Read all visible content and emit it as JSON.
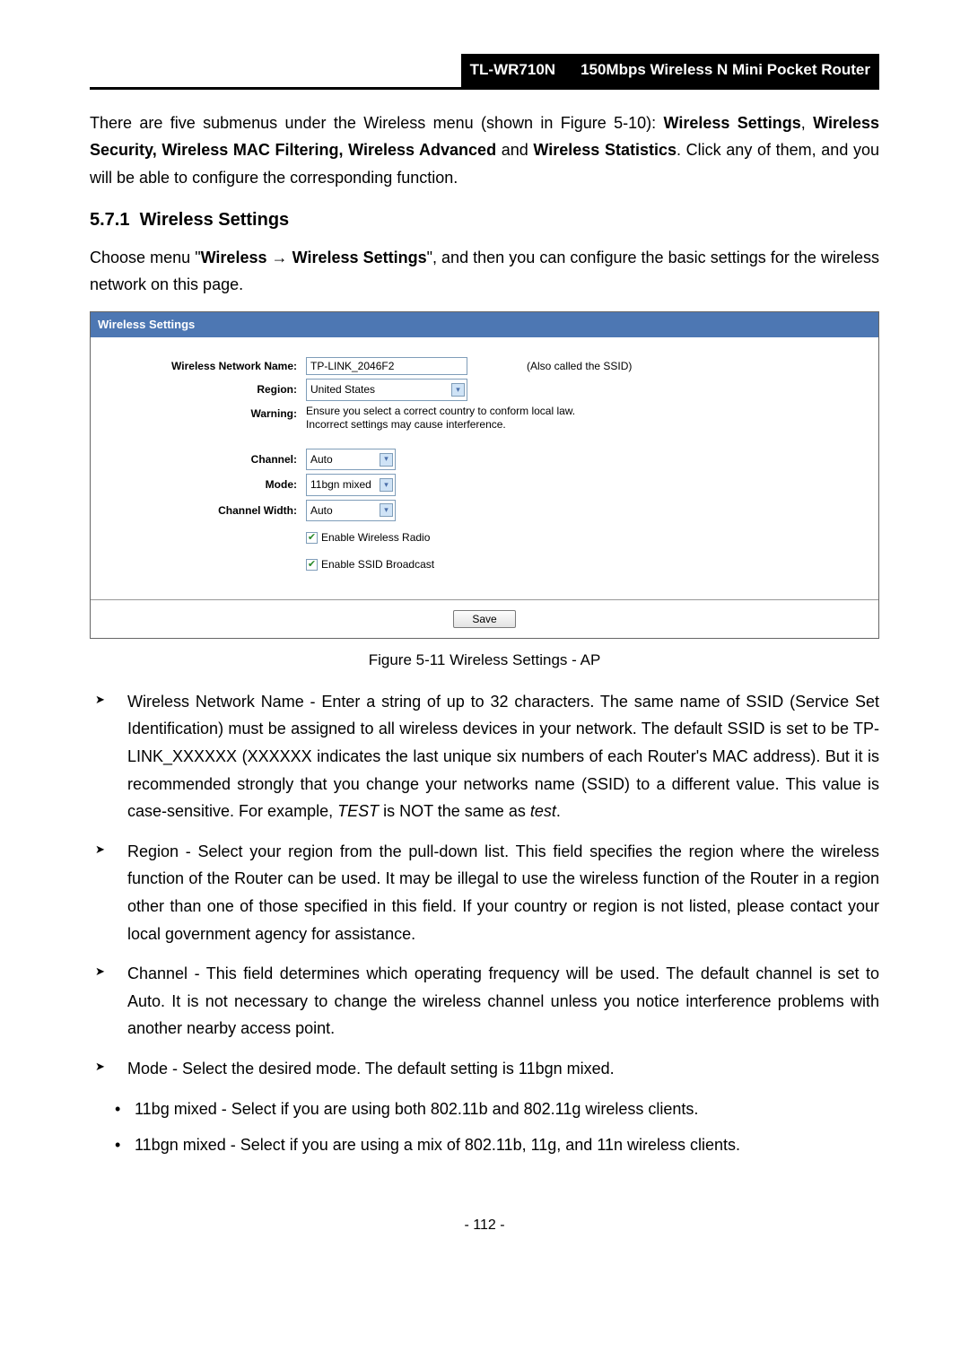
{
  "header": {
    "model": "TL-WR710N",
    "product": "150Mbps Wireless N Mini Pocket Router"
  },
  "intro": {
    "line1_pre": "There are five submenus under the Wireless menu (shown in Figure 5-10): ",
    "b1": "Wireless Settings",
    "comma1": ", ",
    "b2": "Wireless Security, Wireless MAC Filtering, Wireless Advanced",
    "and": " and ",
    "b3": "Wireless Statistics",
    "line1_post": ". Click any of them, and you will be able to configure the corresponding function."
  },
  "section": {
    "num": "5.7.1",
    "title": "Wireless Settings",
    "choose_pre": "Choose menu \"",
    "menu1": "Wireless",
    "arrow": " → ",
    "menu2": "Wireless Settings",
    "choose_post": "\", and then you can configure the basic settings for the wireless network on this page."
  },
  "panel": {
    "title": "Wireless Settings",
    "labels": {
      "wnn": "Wireless Network Name:",
      "region": "Region:",
      "warning": "Warning:",
      "channel": "Channel:",
      "mode": "Mode:",
      "cwidth": "Channel Width:"
    },
    "values": {
      "ssid": "TP-LINK_2046F2",
      "ssid_note": "(Also called the SSID)",
      "region": "United States",
      "warn1": "Ensure you select a correct country to conform local law.",
      "warn2": "Incorrect settings may cause interference.",
      "channel": "Auto",
      "mode": "11bgn mixed",
      "cwidth": "Auto",
      "cb1": "Enable Wireless Radio",
      "cb2": "Enable SSID Broadcast",
      "save": "Save"
    }
  },
  "figcaption": "Figure 5-11 Wireless Settings - AP",
  "bullets": {
    "wnn": {
      "label": "Wireless Network Name - ",
      "t1": "Enter a string of up to 32 characters. The same name of SSID (Service Set Identification) must be assigned to all wireless devices in your network. The default SSID is set to be TP-LINK_XXXXXX (XXXXXX indicates the last unique six numbers of each Router's MAC address). But it is recommended strongly that you change your networks name (SSID) to a different value. This value is case-sensitive. For example, ",
      "i1": "TEST",
      "t2": " is NOT the same as ",
      "i2": "test",
      "t3": "."
    },
    "region": {
      "label": "Region - ",
      "text": "Select your region from the pull-down list. This field specifies the region where the wireless function of the Router can be used. It may be illegal to use the wireless function of the Router in a region other than one of those specified in this field. If your country or region is not listed, please contact your local government agency for assistance."
    },
    "channel": {
      "label": "Channel - ",
      "t1": "This field determines which operating frequency will be used. The default channel is set to ",
      "b1": "Auto",
      "t2": ". It is not necessary to change the wireless channel unless you notice interference problems with another nearby access point."
    },
    "mode": {
      "label": "Mode - ",
      "text": "Select the desired mode. The default setting is 11bgn mixed."
    },
    "sub1": {
      "label": "11bg mixed - ",
      "text": "Select if you are using both 802.11b and 802.11g wireless clients."
    },
    "sub2": {
      "label": "11bgn mixed - ",
      "text": "Select if you are using a mix of 802.11b, 11g, and 11n wireless clients."
    }
  },
  "page": "- 112 -"
}
